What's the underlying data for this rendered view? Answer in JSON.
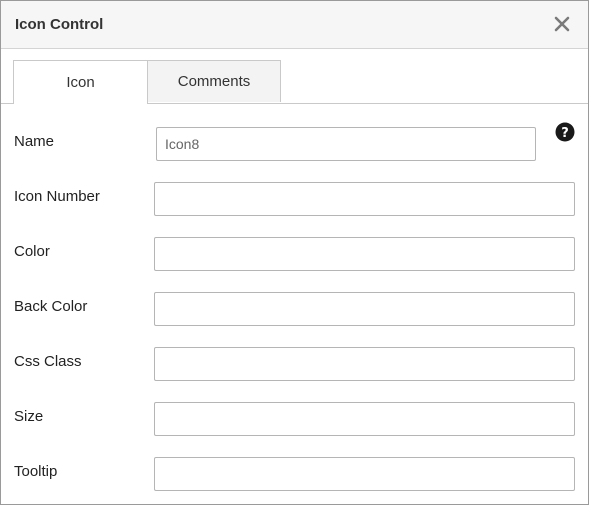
{
  "dialog": {
    "title": "Icon Control",
    "close_icon": "close-icon"
  },
  "tabs": [
    {
      "label": "Icon",
      "active": true
    },
    {
      "label": "Comments",
      "active": false
    }
  ],
  "help_icon": "question-circle-icon",
  "fields": [
    {
      "label": "Name",
      "value": "Icon8"
    },
    {
      "label": "Icon Number",
      "value": ""
    },
    {
      "label": "Color",
      "value": ""
    },
    {
      "label": "Back Color",
      "value": ""
    },
    {
      "label": "Css Class",
      "value": ""
    },
    {
      "label": "Size",
      "value": ""
    },
    {
      "label": "Tooltip",
      "value": ""
    }
  ]
}
